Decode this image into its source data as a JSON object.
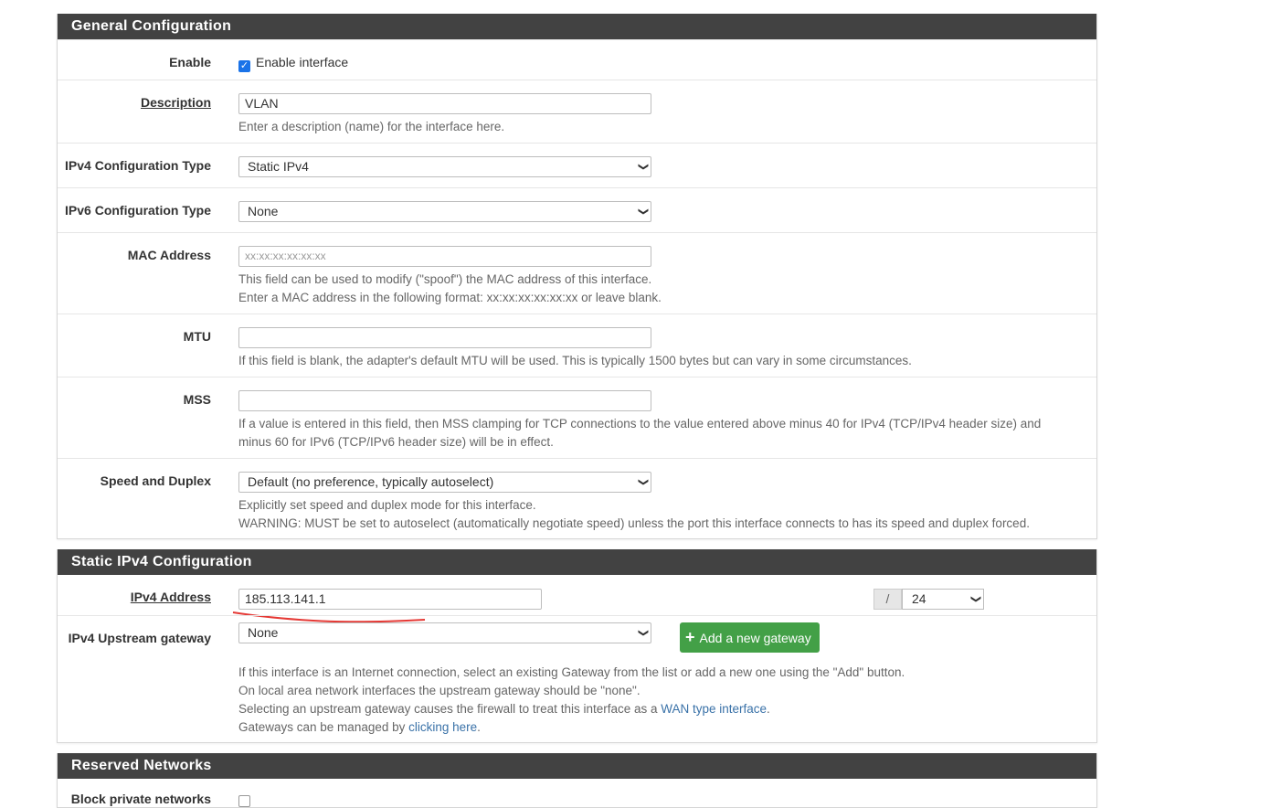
{
  "general": {
    "title": "General Configuration",
    "enable": {
      "label": "Enable",
      "checkbox_label": "Enable interface",
      "checked": true
    },
    "description": {
      "label": "Description",
      "value": "VLAN",
      "help": "Enter a description (name) for the interface here."
    },
    "ipv4_type": {
      "label": "IPv4 Configuration Type",
      "value": "Static IPv4"
    },
    "ipv6_type": {
      "label": "IPv6 Configuration Type",
      "value": "None"
    },
    "mac": {
      "label": "MAC Address",
      "placeholder": "xx:xx:xx:xx:xx:xx",
      "help1": "This field can be used to modify (\"spoof\") the MAC address of this interface.",
      "help2": "Enter a MAC address in the following format: xx:xx:xx:xx:xx:xx or leave blank."
    },
    "mtu": {
      "label": "MTU",
      "help": "If this field is blank, the adapter's default MTU will be used. This is typically 1500 bytes but can vary in some circumstances."
    },
    "mss": {
      "label": "MSS",
      "help1": "If a value is entered in this field, then MSS clamping for TCP connections to the value entered above minus 40 for IPv4 (TCP/IPv4 header size) and",
      "help2": "minus 60 for IPv6 (TCP/IPv6 header size) will be in effect."
    },
    "speed": {
      "label": "Speed and Duplex",
      "value": "Default (no preference, typically autoselect)",
      "help1": "Explicitly set speed and duplex mode for this interface.",
      "help2": "WARNING: MUST be set to autoselect (automatically negotiate speed) unless the port this interface connects to has its speed and duplex forced."
    }
  },
  "static_ipv4": {
    "title": "Static IPv4 Configuration",
    "address": {
      "label": "IPv4 Address",
      "value": "185.113.141.1",
      "slash": "/",
      "cidr": "24"
    },
    "gateway": {
      "label": "IPv4 Upstream gateway",
      "value": "None",
      "add_button": "Add a new gateway",
      "help1": "If this interface is an Internet connection, select an existing Gateway from the list or add a new one using the \"Add\" button.",
      "help2": "On local area network interfaces the upstream gateway should be \"none\".",
      "help3_pre": "Selecting an upstream gateway causes the firewall to treat this interface as a ",
      "help3_link": "WAN type interface",
      "help3_post": ".",
      "help4_pre": "Gateways can be managed by ",
      "help4_link": "clicking here",
      "help4_post": "."
    }
  },
  "reserved": {
    "title": "Reserved Networks",
    "block_private": {
      "label": "Block private networks"
    }
  },
  "colors": {
    "header_bg": "#424242",
    "accent_green": "#43a047",
    "link": "#3a72a8",
    "annotation_red": "#e53935"
  },
  "icons": {
    "dropdown": "chevron-down-icon",
    "add": "plus-icon",
    "check": "check-icon"
  }
}
